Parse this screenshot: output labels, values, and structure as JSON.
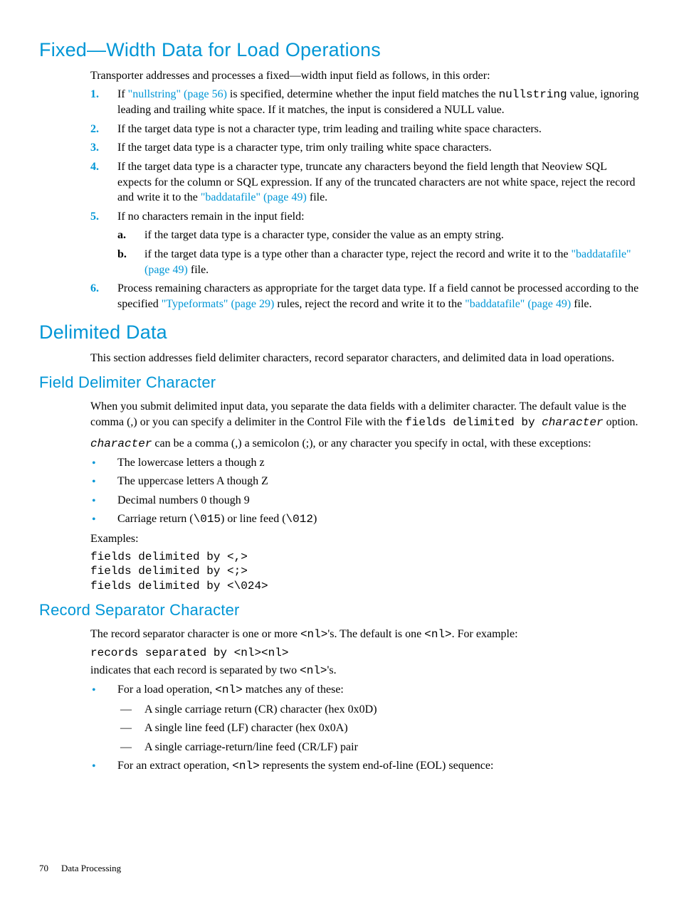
{
  "h1_fixed": "Fixed—Width Data for Load Operations",
  "intro_fixed": "Transporter addresses and processes a fixed—width input field as follows, in this order:",
  "ol1": {
    "m1": "1.",
    "t1a": "If ",
    "t1link": "\"nullstring\" (page 56)",
    "t1b": " is specified, determine whether the input field matches the ",
    "t1code": "nullstring",
    "t1c": " value, ignoring leading and trailing white space. If it matches, the input is considered a NULL value.",
    "m2": "2.",
    "t2": "If the target data type is not a character type, trim leading and trailing white space characters.",
    "m3": "3.",
    "t3": "If the target data type is a character type, trim only trailing white space characters.",
    "m4": "4.",
    "t4a": "If the target data type is a character type, truncate any characters beyond the field length that Neoview SQL expects for the column or SQL expression. If any of the truncated characters are not white space, reject the record and write it to the ",
    "t4link": "\"baddatafile\" (page 49)",
    "t4b": " file.",
    "m5": "5.",
    "t5": "If no characters remain in the input field:",
    "m5a": "a.",
    "t5a": "if the target data type is a character type, consider the value as an empty string.",
    "m5b": "b.",
    "t5b_a": "if the target data type is a type other than a character type, reject the record and write it to the ",
    "t5b_link": "\"baddatafile\" (page 49)",
    "t5b_b": " file.",
    "m6": "6.",
    "t6a": "Process remaining characters as appropriate for the target data type. If a field cannot be processed according to the specified ",
    "t6link1": "\"Typeformats\" (page 29)",
    "t6b": " rules, reject the record and write it to the ",
    "t6link2": "\"baddatafile\" (page 49)",
    "t6c": " file."
  },
  "h1_delim": "Delimited Data",
  "p_delim": "This section addresses field delimiter characters, record separator characters, and delimited data in load operations.",
  "h2_field": "Field Delimiter Character",
  "p_field1a": "When you submit delimited input data, you separate the data fields with a delimiter character. The default value is the comma (,) or you can specify a delimiter in the Control File with the ",
  "p_field1code": "fields delimited by ",
  "p_field1ital": "character",
  "p_field1b": " option.",
  "p_field2ital": "character",
  "p_field2": " can be a comma (,) a semicolon (;), or any character you specify in octal, with these exceptions:",
  "ul_field": {
    "b1": "The lowercase letters a though z",
    "b2": "The uppercase letters A though Z",
    "b3": "Decimal numbers 0 though 9",
    "b4a": "Carriage return (",
    "b4c1": "\\015",
    "b4b": ") or line feed (",
    "b4c2": "\\012",
    "b4c": ")"
  },
  "p_examples": "Examples:",
  "code_examples": "fields delimited by <,>\nfields delimited by <;>\nfields delimited by <\\024>",
  "h2_record": "Record Separator Character",
  "p_rec1a": "The record separator character is one or more ",
  "p_rec1nl1": "<nl>",
  "p_rec1b": "'s. The default is one ",
  "p_rec1nl2": "<nl>",
  "p_rec1c": ". For example:",
  "code_rec": "records separated by <nl><nl>",
  "p_rec2a": "indicates that each record is separated by two ",
  "p_rec2nl": "<nl>",
  "p_rec2b": "'s.",
  "ul_rec": {
    "b1a": "For a load operation, ",
    "b1nl": "<nl>",
    "b1b": " matches any of these:",
    "d1": "A single carriage return (CR) character (hex 0x0D)",
    "d2": "A single line feed (LF) character (hex 0x0A)",
    "d3": "A single carriage-return/line feed (CR/LF) pair",
    "b2a": "For an extract operation, ",
    "b2nl": "<nl>",
    "b2b": " represents the system end-of-line (EOL) sequence:"
  },
  "footer": {
    "page": "70",
    "section": "Data Processing"
  }
}
